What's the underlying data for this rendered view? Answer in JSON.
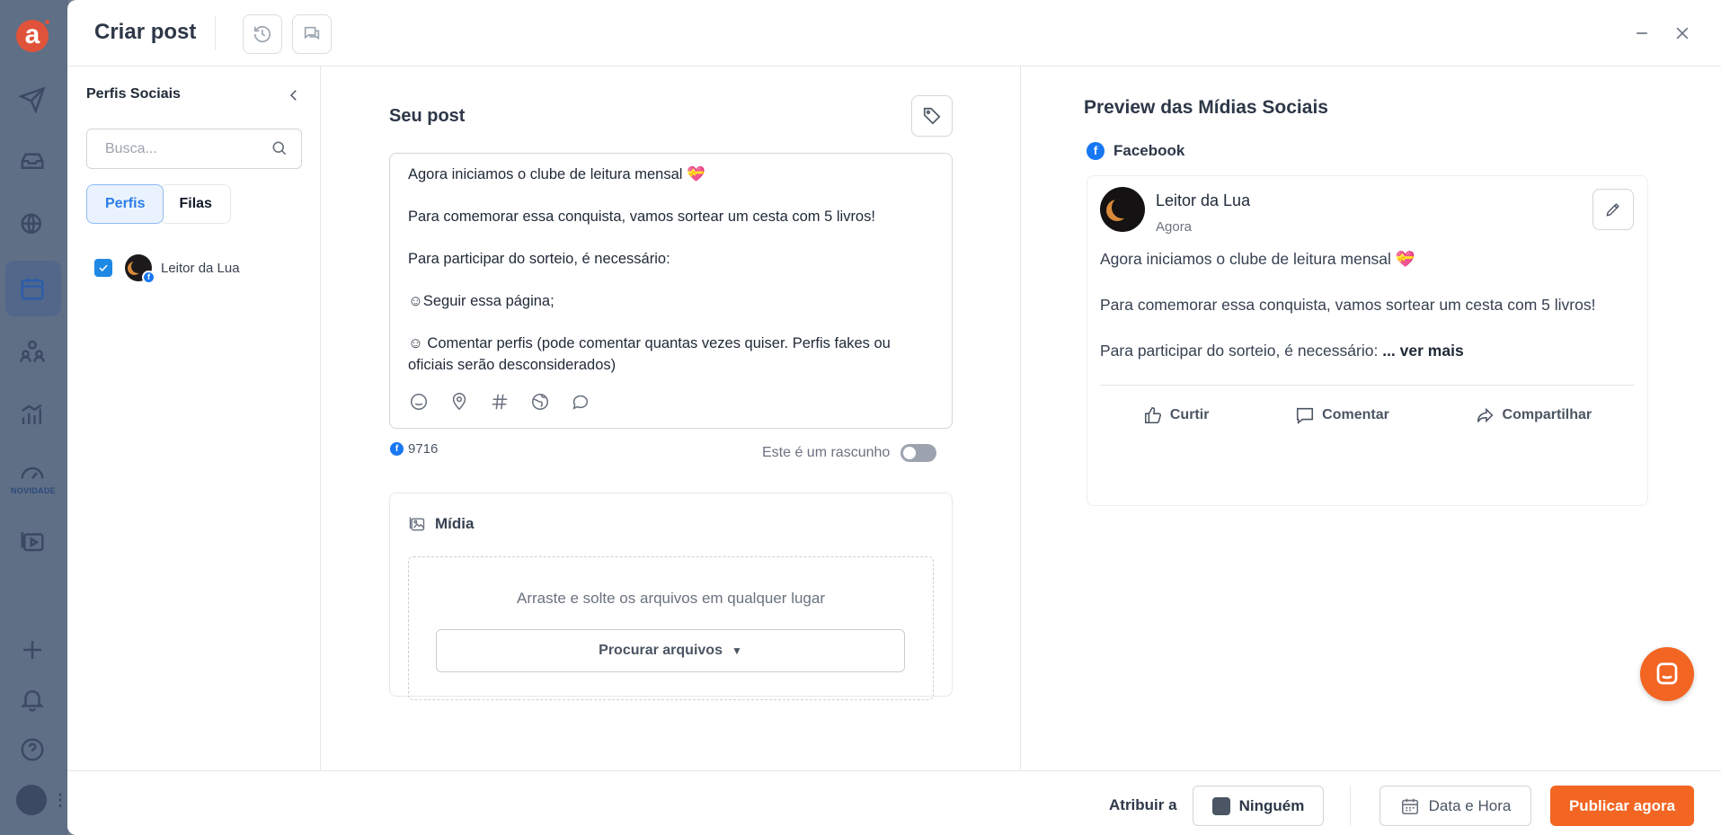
{
  "app_rail": {
    "new_badge": "NOVIDADE"
  },
  "header": {
    "title": "Criar post"
  },
  "profiles_panel": {
    "title": "Perfis Sociais",
    "search_placeholder": "Busca...",
    "tabs": [
      {
        "label": "Perfis",
        "active": true
      },
      {
        "label": "Filas",
        "active": false
      }
    ],
    "items": [
      {
        "name": "Leitor da Lua",
        "checked": true,
        "network": "facebook"
      }
    ]
  },
  "post": {
    "title": "Seu post",
    "text": "Agora iniciamos o clube de leitura mensal 💝\n\nPara comemorar essa conquista, vamos sortear um cesta com 5 livros!\n\nPara participar do sorteio, é necessário:\n\n☺Seguir essa página;\n\n☺ Comentar perfis (pode comentar quantas vezes quiser. Perfis fakes ou oficiais serão desconsiderados)",
    "char_count": "9716",
    "draft_label": "Este é um rascunho",
    "draft_on": false,
    "toolbar_icons": [
      "emoji-icon",
      "location-icon",
      "hashtag-icon",
      "globe-icon",
      "chat-icon"
    ]
  },
  "media": {
    "title": "Mídia",
    "drop_text": "Arraste e solte os arquivos em qualquer lugar",
    "browse_label": "Procurar arquivos",
    "browse_caret": "▼"
  },
  "preview": {
    "title": "Preview das Mídias Sociais",
    "network": "Facebook",
    "author": "Leitor da Lua",
    "time": "Agora",
    "lines": [
      "Agora iniciamos o clube de leitura mensal 💝",
      "Para comemorar essa conquista, vamos sortear um cesta com 5 livros!",
      "Para participar do sorteio, é necessário: "
    ],
    "see_more": "... ver mais",
    "actions": {
      "like": "Curtir",
      "comment": "Comentar",
      "share": "Compartilhar"
    }
  },
  "footer": {
    "assign_label": "Atribuir a",
    "assignee": "Ninguém",
    "date_label": "Data e Hora",
    "publish_label": "Publicar agora"
  },
  "colors": {
    "accent": "#f26522",
    "primary": "#1e88e5",
    "facebook": "#1877f2"
  }
}
